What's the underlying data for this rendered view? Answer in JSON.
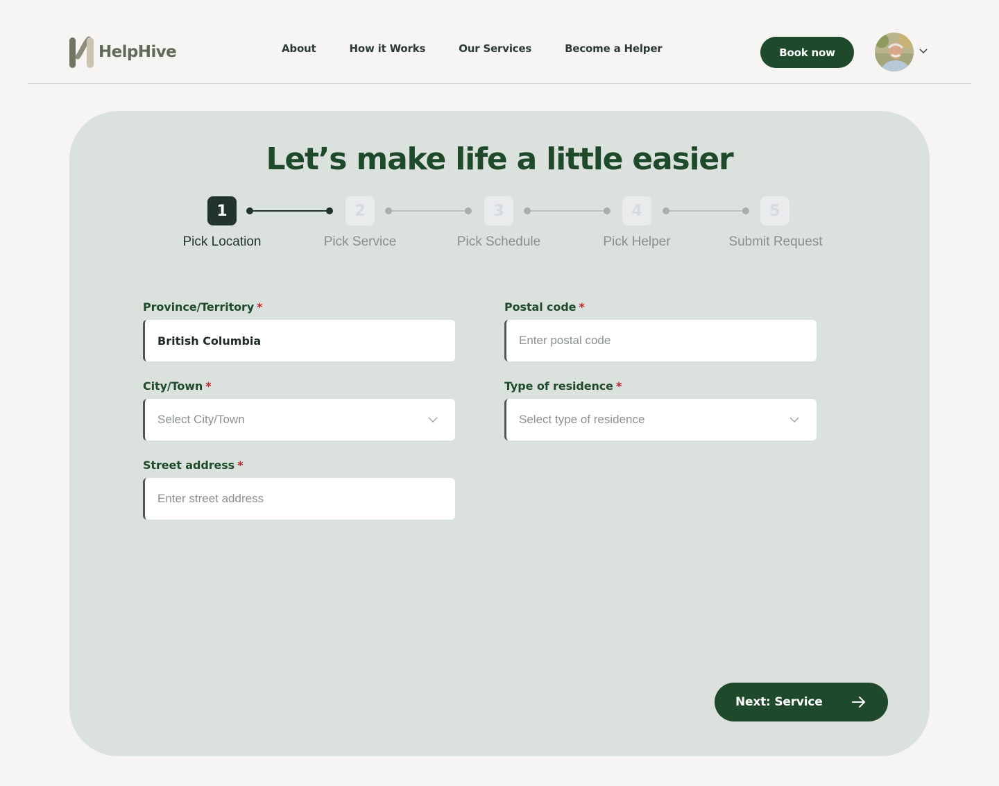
{
  "header": {
    "brand": "HelpHive",
    "nav": [
      "About",
      "How it Works",
      "Our Services",
      "Become a Helper"
    ],
    "book_label": "Book now"
  },
  "main": {
    "title": "Let’s make life a little easier",
    "steps": [
      {
        "number": "1",
        "label": "Pick Location",
        "state": "active"
      },
      {
        "number": "2",
        "label": "Pick Service",
        "state": "inactive"
      },
      {
        "number": "3",
        "label": "Pick Schedule",
        "state": "inactive"
      },
      {
        "number": "4",
        "label": "Pick Helper",
        "state": "inactive"
      },
      {
        "number": "5",
        "label": "Submit Request",
        "state": "inactive"
      }
    ],
    "form": {
      "province": {
        "label": "Province/Territory",
        "required_mark": "*",
        "value": "British Columbia"
      },
      "postal": {
        "label": "Postal code",
        "required_mark": "*",
        "placeholder": "Enter postal code"
      },
      "city": {
        "label": "City/Town",
        "required_mark": "*",
        "placeholder": "Select City/Town"
      },
      "residence": {
        "label": "Type of residence",
        "required_mark": "*",
        "placeholder": "Select type of residence"
      },
      "street": {
        "label": "Street address",
        "required_mark": "*",
        "placeholder": "Enter street address"
      }
    },
    "next_label": "Next: Service"
  },
  "colors": {
    "brand_green": "#1e4a2b",
    "card_bg": "#dbe1dd",
    "page_bg": "#f6f5f3",
    "required": "#c0242b",
    "step_active": "#22322c"
  },
  "icons": {
    "logo": "helphive-logo-icon",
    "avatar_chevron": "chevron-down-icon",
    "select_chevron": "chevron-down-icon",
    "next": "arrow-right-icon"
  }
}
